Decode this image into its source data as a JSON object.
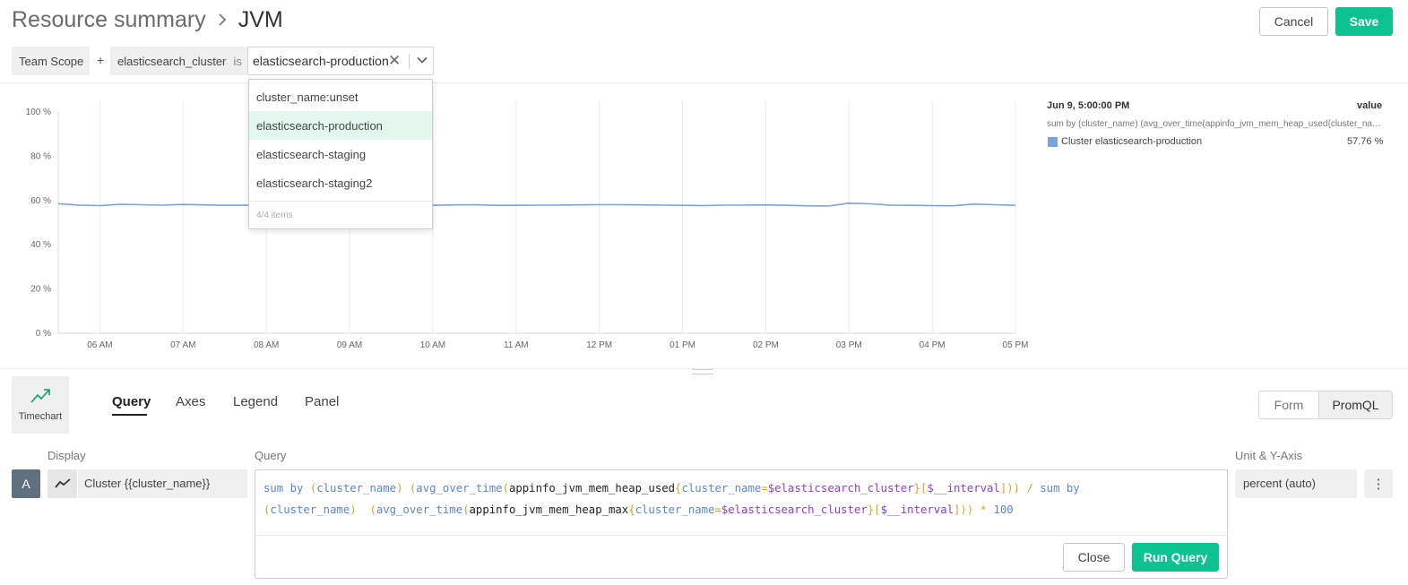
{
  "header": {
    "breadcrumb_parent": "Resource summary",
    "breadcrumb_current": "JVM",
    "cancel_label": "Cancel",
    "save_label": "Save"
  },
  "scope": {
    "team_scope_label": "Team Scope",
    "plus_label": "+",
    "filter_key": "elasticsearch_cluster",
    "filter_operator": "is",
    "filter_value": "elasticsearch-production",
    "clear_glyph": "✕"
  },
  "dropdown": {
    "options": [
      "cluster_name:unset",
      "elasticsearch-production",
      "elasticsearch-staging",
      "elasticsearch-staging2"
    ],
    "selected": "elasticsearch-production",
    "count_label": "4/4 items"
  },
  "legend": {
    "time": "Jun 9, 5:00:00 PM",
    "value_header": "value",
    "query_text": "sum by (cluster_name) (avg_over_time(appinfo_jvm_mem_heap_used{cluster_name=$elasticsearch_cluster}[$__interval])) / sum by (cluster_name) (avg_over_time(appinfo_jvm_mem_heap_max{cluster_name=$elasticsearch_cluster}[$__interval])) * 100",
    "series_label": "Cluster elasticsearch-production",
    "series_value": "57.76 %"
  },
  "chart_data": {
    "type": "line",
    "x": [
      "05:30 AM",
      "05:45 AM",
      "06:00 AM",
      "06:15 AM",
      "06:30 AM",
      "06:45 AM",
      "07:00 AM",
      "07:15 AM",
      "07:30 AM",
      "07:45 AM",
      "08:00 AM",
      "08:15 AM",
      "08:30 AM",
      "08:45 AM",
      "09:00 AM",
      "09:15 AM",
      "09:30 AM",
      "09:45 AM",
      "10:00 AM",
      "10:15 AM",
      "10:30 AM",
      "10:45 AM",
      "11:00 AM",
      "11:15 AM",
      "11:30 AM",
      "11:45 AM",
      "12:00 PM",
      "12:15 PM",
      "12:30 PM",
      "12:45 PM",
      "01:00 PM",
      "01:15 PM",
      "01:30 PM",
      "01:45 PM",
      "02:00 PM",
      "02:15 PM",
      "02:30 PM",
      "02:45 PM",
      "03:00 PM",
      "03:15 PM",
      "03:30 PM",
      "03:45 PM",
      "04:00 PM",
      "04:15 PM",
      "04:30 PM",
      "04:45 PM",
      "05:00 PM"
    ],
    "x_tick_labels": [
      "06 AM",
      "07 AM",
      "08 AM",
      "09 AM",
      "10 AM",
      "11 AM",
      "12 PM",
      "01 PM",
      "02 PM",
      "03 PM",
      "04 PM",
      "05 PM"
    ],
    "y_tick_labels": [
      "0 %",
      "20 %",
      "40 %",
      "60 %",
      "80 %",
      "100 %"
    ],
    "ylim": [
      0,
      100
    ],
    "grid": true,
    "series": [
      {
        "name": "Cluster elasticsearch-production",
        "color": "#7aa0e0",
        "values": [
          58.6,
          57.9,
          57.7,
          58.3,
          58.1,
          57.9,
          58.2,
          58.0,
          57.8,
          57.9,
          57.7,
          57.8,
          58.1,
          58.0,
          57.9,
          57.9,
          58.0,
          57.9,
          57.8,
          58.0,
          58.1,
          57.8,
          57.8,
          57.9,
          57.9,
          58.0,
          58.1,
          58.1,
          58.0,
          57.9,
          57.8,
          57.7,
          57.9,
          57.9,
          58.0,
          57.8,
          57.6,
          57.5,
          58.8,
          58.5,
          57.9,
          57.8,
          57.7,
          57.6,
          58.4,
          58.1,
          57.8
        ]
      }
    ]
  },
  "editor": {
    "viz_label": "Timechart",
    "tabs": [
      "Query",
      "Axes",
      "Legend",
      "Panel"
    ],
    "active_tab": "Query",
    "mode_options": [
      "Form",
      "PromQL"
    ],
    "active_mode": "PromQL",
    "display_label": "Display",
    "query_label": "Query",
    "unit_label": "Unit & Y-Axis",
    "series_letter": "A",
    "legend_format": "Cluster {{cluster_name}}",
    "unit_value": "percent (auto)",
    "kebab_glyph": "⋮",
    "close_label": "Close",
    "run_label": "Run Query"
  },
  "query": {
    "line1": [
      {
        "t": "sum by",
        "c": "kw"
      },
      {
        "t": " ",
        "c": ""
      },
      {
        "t": "(",
        "c": "paren"
      },
      {
        "t": "cluster_name",
        "c": "kw"
      },
      {
        "t": ")",
        "c": "paren"
      },
      {
        "t": " ",
        "c": ""
      },
      {
        "t": "(",
        "c": "paren"
      },
      {
        "t": "avg_over_time",
        "c": "kw"
      },
      {
        "t": "(",
        "c": "paren"
      },
      {
        "t": "appinfo_jvm_mem_heap_used",
        "c": "fn"
      },
      {
        "t": "{",
        "c": "paren"
      },
      {
        "t": "cluster_name",
        "c": "kw"
      },
      {
        "t": "=",
        "c": "op"
      },
      {
        "t": "$elasticsearch_cluster",
        "c": "var"
      },
      {
        "t": "}",
        "c": "paren"
      },
      {
        "t": "[",
        "c": "paren"
      },
      {
        "t": "$__interval",
        "c": "var"
      },
      {
        "t": "]",
        "c": "paren"
      },
      {
        "t": "))",
        "c": "paren"
      },
      {
        "t": " / ",
        "c": "op"
      },
      {
        "t": "sum by",
        "c": "kw"
      }
    ],
    "line2": [
      {
        "t": "(",
        "c": "paren"
      },
      {
        "t": "cluster_name",
        "c": "kw"
      },
      {
        "t": ")",
        "c": "paren"
      },
      {
        "t": "  ",
        "c": ""
      },
      {
        "t": "(",
        "c": "paren"
      },
      {
        "t": "avg_over_time",
        "c": "kw"
      },
      {
        "t": "(",
        "c": "paren"
      },
      {
        "t": "appinfo_jvm_mem_heap_max",
        "c": "fn"
      },
      {
        "t": "{",
        "c": "paren"
      },
      {
        "t": "cluster_name",
        "c": "kw"
      },
      {
        "t": "=",
        "c": "op"
      },
      {
        "t": "$elasticsearch_cluster",
        "c": "var"
      },
      {
        "t": "}",
        "c": "paren"
      },
      {
        "t": "[",
        "c": "paren"
      },
      {
        "t": "$__interval",
        "c": "var"
      },
      {
        "t": "]",
        "c": "paren"
      },
      {
        "t": "))",
        "c": "paren"
      },
      {
        "t": " * ",
        "c": "op"
      },
      {
        "t": "100",
        "c": "kw"
      }
    ]
  }
}
